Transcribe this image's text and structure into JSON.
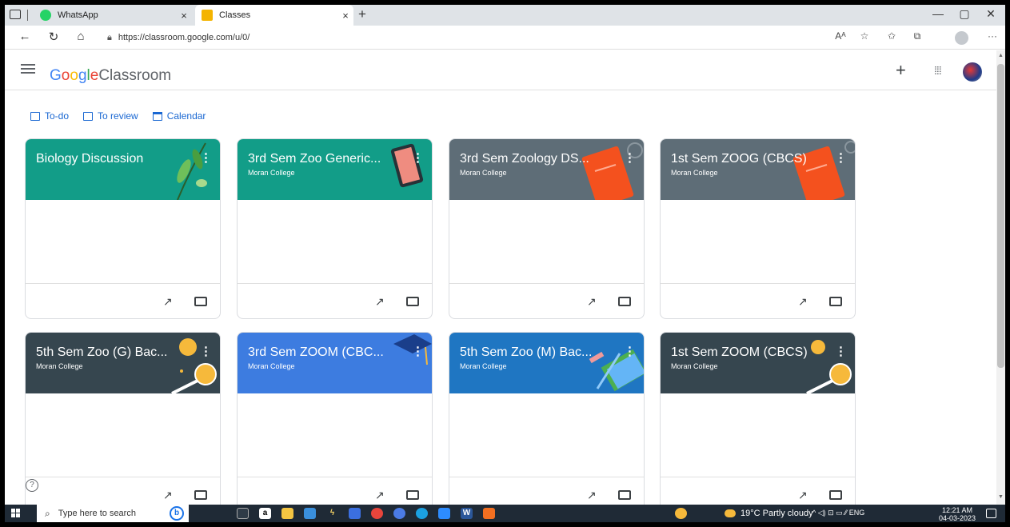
{
  "browser": {
    "tabs": [
      {
        "label": "WhatsApp",
        "close": "×"
      },
      {
        "label": "Classes",
        "close": "×"
      }
    ],
    "new_tab": "+",
    "window_controls": [
      "—",
      "▢",
      "✕"
    ],
    "url": "https://classroom.google.com/u/0/",
    "nav": {
      "back": "←",
      "reload": "↻",
      "home": "⌂"
    },
    "right_controls": [
      "Aᴬ",
      "☆",
      "✩",
      "⧉",
      "···"
    ]
  },
  "header": {
    "logo_g": [
      "G",
      "o",
      "o",
      "g",
      "l",
      "e"
    ],
    "logo_product": "Classroom",
    "add": "+",
    "apps": "⁞⁞⁞"
  },
  "filters": {
    "todo": "To-do",
    "review": "To review",
    "calendar": "Calendar"
  },
  "classes": [
    {
      "title": "Biology Discussion",
      "section": "",
      "color": "#129d88"
    },
    {
      "title": "3rd Sem Zoo Generic...",
      "section": "Moran College",
      "color": "#129d88"
    },
    {
      "title": "3rd Sem Zoology DS...",
      "section": "Moran College",
      "color": "#5e6d77"
    },
    {
      "title": "1st Sem ZOOG (CBCS)",
      "section": "Moran College",
      "color": "#5e6d77"
    },
    {
      "title": "5th Sem Zoo (G) Bac...",
      "section": "Moran College",
      "color": "#36464f"
    },
    {
      "title": "3rd Sem ZOOM (CBC...",
      "section": "Moran College",
      "color": "#3d7ce0"
    },
    {
      "title": "5th Sem Zoo (M) Bac...",
      "section": "Moran College",
      "color": "#1f76c2"
    },
    {
      "title": "1st Sem ZOOM (CBCS)",
      "section": "Moran College",
      "color": "#36464f"
    }
  ],
  "help": "?",
  "taskbar": {
    "search_placeholder": "Type here to search",
    "bing": "b",
    "weather": "19°C  Partly cloudy",
    "tray": "^  ◁)  ⊡  ▭  ⁄⁄  ENG",
    "time": "12:21 AM",
    "date": "04-03-2023"
  }
}
